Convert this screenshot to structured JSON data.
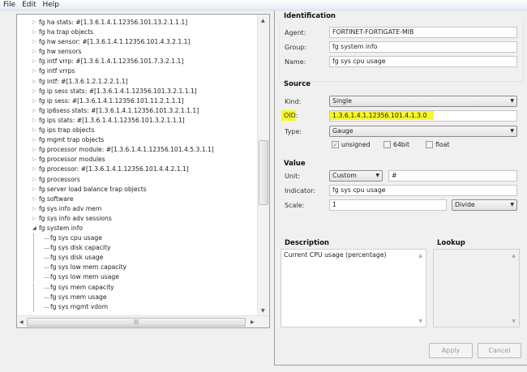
{
  "menu": [
    "File",
    "Edit",
    "Help"
  ],
  "tree": [
    {
      "label": "fg ha stats: #[1.3.6.1.4.1.12356.101.13.2.1.1.1]",
      "expanded": false
    },
    {
      "label": "fg ha trap objects",
      "expanded": false
    },
    {
      "label": "fg hw sensor: #[1.3.6.1.4.1.12356.101.4.3.2.1.1]",
      "expanded": false
    },
    {
      "label": "fg hw sensors",
      "expanded": false
    },
    {
      "label": "fg intf vrrp: #[1.3.6.1.4.1.12356.101.7.3.2.1.1]",
      "expanded": false
    },
    {
      "label": "fg intf vrrps",
      "expanded": false
    },
    {
      "label": "fg intf: #[1.3.6.1.2.1.2.2.1.1]",
      "expanded": false
    },
    {
      "label": "fg ip sess stats: #[1.3.6.1.4.1.12356.101.3.2.1.1.1]",
      "expanded": false
    },
    {
      "label": "fg ip sess: #[1.3.6.1.4.1.12356.101.11.2.1.1.1]",
      "expanded": false
    },
    {
      "label": "fg ip6sess stats: #[1.3.6.1.4.1.12356.101.3.2.1.1.1]",
      "expanded": false
    },
    {
      "label": "fg ips stats: #[1.3.6.1.4.1.12356.101.3.2.1.1.1]",
      "expanded": false
    },
    {
      "label": "fg ips trap objects",
      "expanded": false
    },
    {
      "label": "fg mgmt trap objects",
      "expanded": false
    },
    {
      "label": "fg processor module: #[1.3.6.1.4.1.12356.101.4.5.3.1.1]",
      "expanded": false
    },
    {
      "label": "fg processor modules",
      "expanded": false
    },
    {
      "label": "fg processor: #[1.3.6.1.4.1.12356.101.4.4.2.1.1]",
      "expanded": false
    },
    {
      "label": "fg processors",
      "expanded": false
    },
    {
      "label": "fg server load balance trap objects",
      "expanded": false
    },
    {
      "label": "fg software",
      "expanded": false
    },
    {
      "label": "fg sys info adv mem",
      "expanded": false
    },
    {
      "label": "fg sys info adv sessions",
      "expanded": false
    },
    {
      "label": "fg system info",
      "expanded": true
    },
    {
      "label": "fg sys cpu usage",
      "child": true
    },
    {
      "label": "fg sys disk capacity",
      "child": true
    },
    {
      "label": "fg sys disk usage",
      "child": true
    },
    {
      "label": "fg sys low mem capacity",
      "child": true
    },
    {
      "label": "fg sys low mem usage",
      "child": true
    },
    {
      "label": "fg sys mem capacity",
      "child": true
    },
    {
      "label": "fg sys mem usage",
      "child": true
    },
    {
      "label": "fg sys mgmt vdom",
      "child": true
    }
  ],
  "identification": {
    "title": "Identification",
    "agent_label": "Agent:",
    "agent": "FORTINET-FORTIGATE-MIB",
    "group_label": "Group:",
    "group": "fg system info",
    "name_label": "Name:",
    "name": "fg sys cpu usage"
  },
  "source": {
    "title": "Source",
    "kind_label": "Kind:",
    "kind": "Single",
    "oid_label": "OID:",
    "oid": "1.3.6.1.4.1.12356.101.4.1.3.0",
    "type_label": "Type:",
    "type": "Gauge",
    "unsigned": "unsigned",
    "unsigned_checked": true,
    "bit64": "64bit",
    "float": "float"
  },
  "value": {
    "title": "Value",
    "unit_label": "Unit:",
    "unit": "Custom",
    "unit_symbol": "#",
    "indicator_label": "Indicator:",
    "indicator": "fg sys cpu usage",
    "scale_label": "Scale:",
    "scale": "1",
    "scale_op": "Divide"
  },
  "description": {
    "title": "Description",
    "text": "Current CPU usage (percentage)"
  },
  "lookup": {
    "title": "Lookup"
  },
  "buttons": {
    "apply": "Apply",
    "cancel": "Cancel"
  },
  "colors": {
    "highlight": "#f7f72a"
  }
}
